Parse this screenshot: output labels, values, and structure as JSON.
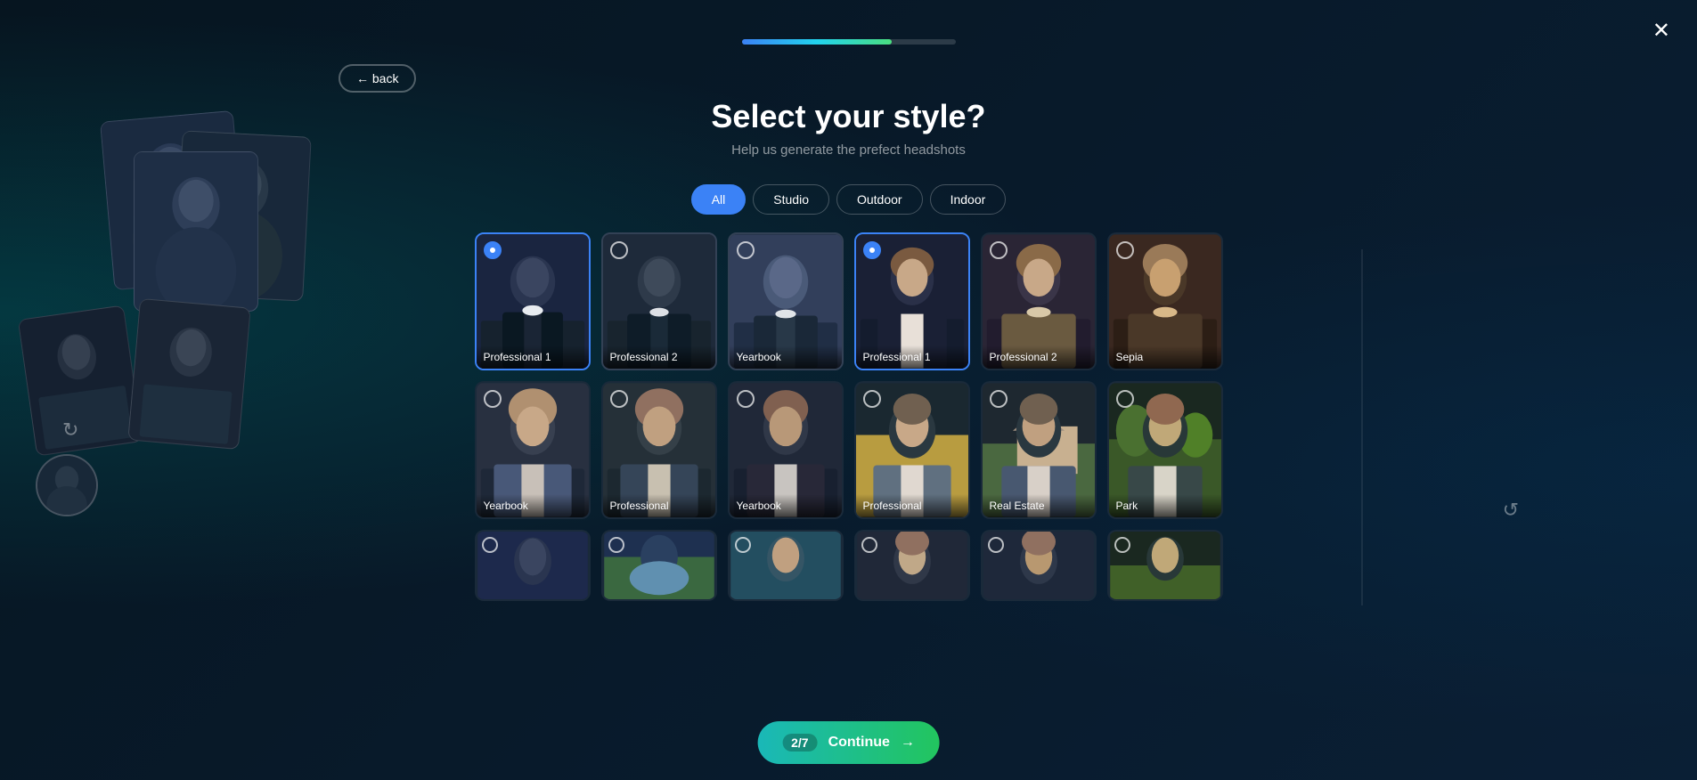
{
  "header": {
    "title": "Select your style?",
    "subtitle": "Help us generate the prefect headshots",
    "back_label": "← back",
    "close_label": "✕",
    "progress_percent": 70
  },
  "filters": {
    "tabs": [
      {
        "id": "all",
        "label": "All",
        "active": true
      },
      {
        "id": "studio",
        "label": "Studio",
        "active": false
      },
      {
        "id": "outdoor",
        "label": "Outdoor",
        "active": false
      },
      {
        "id": "indoor",
        "label": "Indoor",
        "active": false
      }
    ]
  },
  "grid": {
    "row1": [
      {
        "id": "p1",
        "label": "Professional 1",
        "selected": true,
        "theme": "male-1"
      },
      {
        "id": "p2",
        "label": "Professional 2",
        "selected": false,
        "theme": "male-2"
      },
      {
        "id": "y1",
        "label": "Yearbook",
        "selected": false,
        "theme": "yearbook-1"
      },
      {
        "id": "p3",
        "label": "Professional 1",
        "selected": true,
        "theme": "female-1"
      },
      {
        "id": "p4",
        "label": "Professional 2",
        "selected": false,
        "theme": "female-2"
      },
      {
        "id": "s1",
        "label": "Sepia",
        "selected": false,
        "theme": "sepia-1"
      }
    ],
    "row2": [
      {
        "id": "fy1",
        "label": "Yearbook",
        "selected": false,
        "theme": "female-yearbook"
      },
      {
        "id": "fp1",
        "label": "Professional",
        "selected": false,
        "theme": "female-prof"
      },
      {
        "id": "fy2",
        "label": "Yearbook",
        "selected": false,
        "theme": "female-yearbook2"
      },
      {
        "id": "om1",
        "label": "Professional",
        "selected": false,
        "theme": "outdoor-male"
      },
      {
        "id": "re1",
        "label": "Real Estate",
        "selected": false,
        "theme": "realestate"
      },
      {
        "id": "pk1",
        "label": "Park",
        "selected": false,
        "theme": "park"
      }
    ],
    "row3": [
      {
        "id": "r3a",
        "label": "",
        "selected": false,
        "theme": "male-1"
      },
      {
        "id": "r3b",
        "label": "",
        "selected": false,
        "theme": "yearbook-1"
      },
      {
        "id": "r3c",
        "label": "",
        "selected": false,
        "theme": "female-1"
      },
      {
        "id": "r3d",
        "label": "",
        "selected": false,
        "theme": "female-yearbook"
      },
      {
        "id": "r3e",
        "label": "",
        "selected": false,
        "theme": "female-2"
      },
      {
        "id": "r3f",
        "label": "",
        "selected": false,
        "theme": "park"
      }
    ]
  },
  "continue": {
    "badge": "2/7",
    "label": "Continue",
    "arrow": "→"
  }
}
